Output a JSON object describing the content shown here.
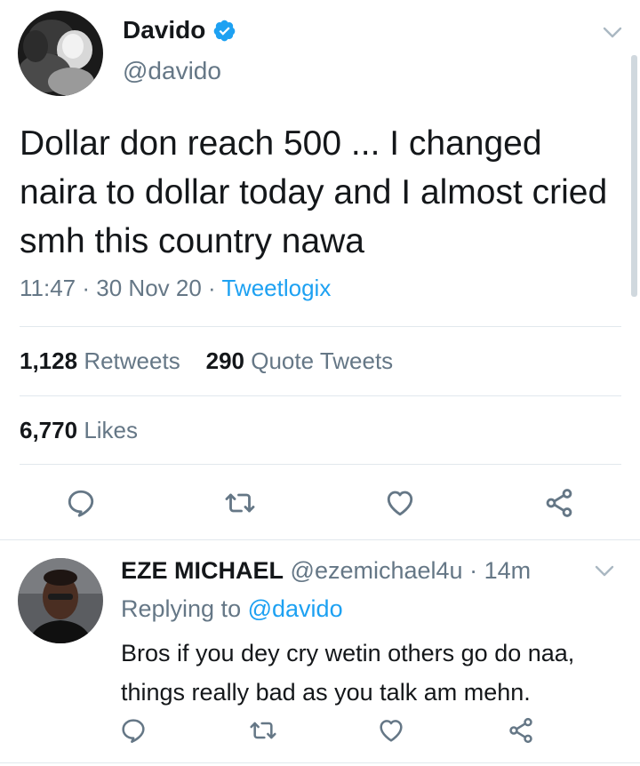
{
  "main_tweet": {
    "display_name": "Davido",
    "handle": "@davido",
    "verified": true,
    "text": "Dollar don reach 500 ... I changed naira to dollar today and I almost cried smh this country nawa",
    "time": "11:47",
    "date": "30 Nov 20",
    "source": "Tweetlogix",
    "retweets_count": "1,128",
    "retweets_label": "Retweets",
    "quote_count": "290",
    "quote_label": "Quote Tweets",
    "likes_count": "6,770",
    "likes_label": "Likes"
  },
  "reply": {
    "display_name": "EZE MICHAEL",
    "handle": "@ezemichael4u",
    "time": "14m",
    "replying_label": "Replying to",
    "replying_to": "@davido",
    "text": "Bros if you dey cry wetin others go do naa, things really bad as you talk am mehn."
  },
  "icons": [
    "chevron-down-icon",
    "verified-badge-icon",
    "reply-icon",
    "retweet-icon",
    "like-icon",
    "share-icon"
  ],
  "colors": {
    "accent": "#1da1f2",
    "secondary_text": "#657786",
    "primary_text": "#14171a",
    "divider": "#e1e8ed"
  }
}
